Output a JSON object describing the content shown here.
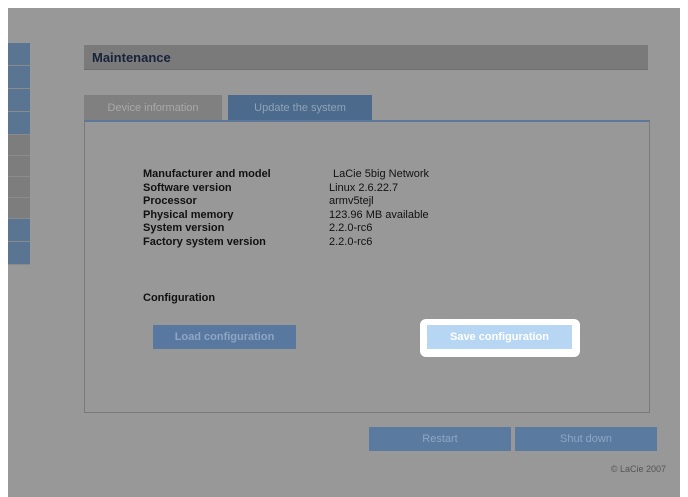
{
  "header": {
    "title": "Maintenance"
  },
  "tabs": [
    {
      "label": "Device information",
      "active": false
    },
    {
      "label": "Update the system",
      "active": true
    }
  ],
  "device_info": [
    {
      "label": "Manufacturer and model",
      "value": "LaCie 5big Network"
    },
    {
      "label": "Software version",
      "value": "Linux 2.6.22.7"
    },
    {
      "label": "Processor",
      "value": "armv5tejl"
    },
    {
      "label": "Physical memory",
      "value": "123.96 MB available"
    },
    {
      "label": "System version",
      "value": "2.2.0-rc6"
    },
    {
      "label": "Factory system version",
      "value": "2.2.0-rc6"
    }
  ],
  "configuration": {
    "heading": "Configuration",
    "load_label": "Load configuration",
    "save_label": "Save configuration"
  },
  "actions": {
    "restart_label": "Restart",
    "shutdown_label": "Shut down"
  },
  "footer": {
    "copyright": "© LaCie 2007"
  },
  "colors": {
    "overlay_background": "#989898",
    "accent_blue": "#5a7591",
    "highlight_button": "#b6d6f4",
    "title_text": "#17233a"
  }
}
